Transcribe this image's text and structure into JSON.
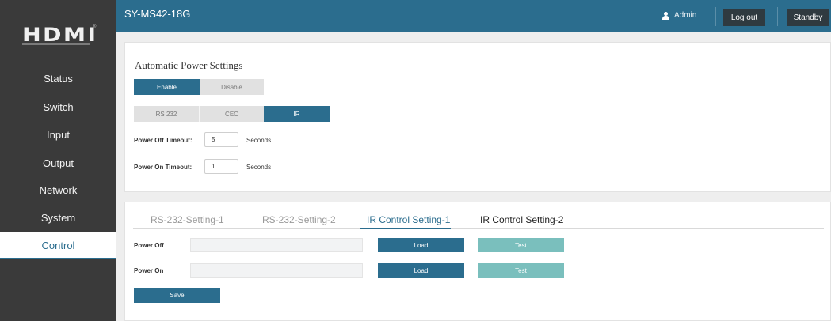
{
  "logo": {
    "text": "HDMI",
    "tm": "®"
  },
  "sidebar": {
    "items": [
      {
        "label": "Status"
      },
      {
        "label": "Switch"
      },
      {
        "label": "Input"
      },
      {
        "label": "Output"
      },
      {
        "label": "Network"
      },
      {
        "label": "System"
      },
      {
        "label": "Control",
        "active": true
      }
    ]
  },
  "header": {
    "title": "SY-MS42-18G",
    "user": "Admin",
    "logout_label": "Log out",
    "standby_label": "Standby"
  },
  "power": {
    "title": "Automatic Power Settings",
    "enable_label": "Enable",
    "disable_label": "Disable",
    "enabled": true,
    "modes": [
      "RS 232",
      "CEC",
      "IR"
    ],
    "selected_mode": "IR",
    "off_timeout_label": "Power Off Timeout:",
    "off_timeout_value": "5",
    "on_timeout_label": "Power On Timeout:",
    "on_timeout_value": "1",
    "unit": "Seconds"
  },
  "control": {
    "tabs": [
      "RS-232-Setting-1",
      "RS-232-Setting-2",
      "IR Control Setting-1",
      "IR Control Setting-2"
    ],
    "active_tab": "IR Control Setting-1",
    "rows": [
      {
        "label": "Power Off",
        "load": "Load",
        "test": "Test"
      },
      {
        "label": "Power On",
        "load": "Load",
        "test": "Test"
      }
    ],
    "save_label": "Save"
  },
  "colors": {
    "accent": "#2b6d8e",
    "test": "#7abfbd",
    "sidebar": "#3a3a3a"
  }
}
